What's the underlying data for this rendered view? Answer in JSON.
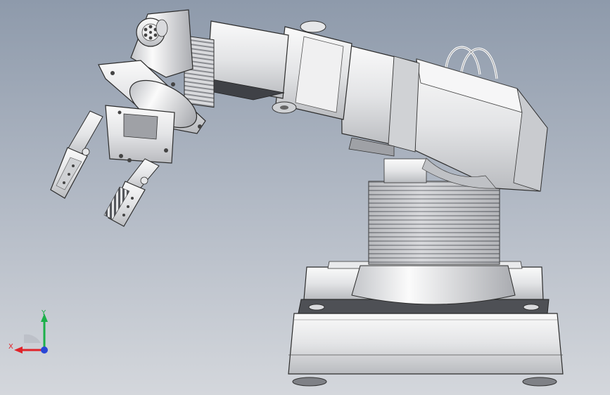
{
  "viewport": {
    "background_top": "#8e9aab",
    "background_bottom": "#d4d7dc"
  },
  "triad": {
    "x_label": "X",
    "y_label": "Y",
    "x_color": "#e0242a",
    "y_color": "#1cb04a",
    "z_color": "#2946d6"
  }
}
